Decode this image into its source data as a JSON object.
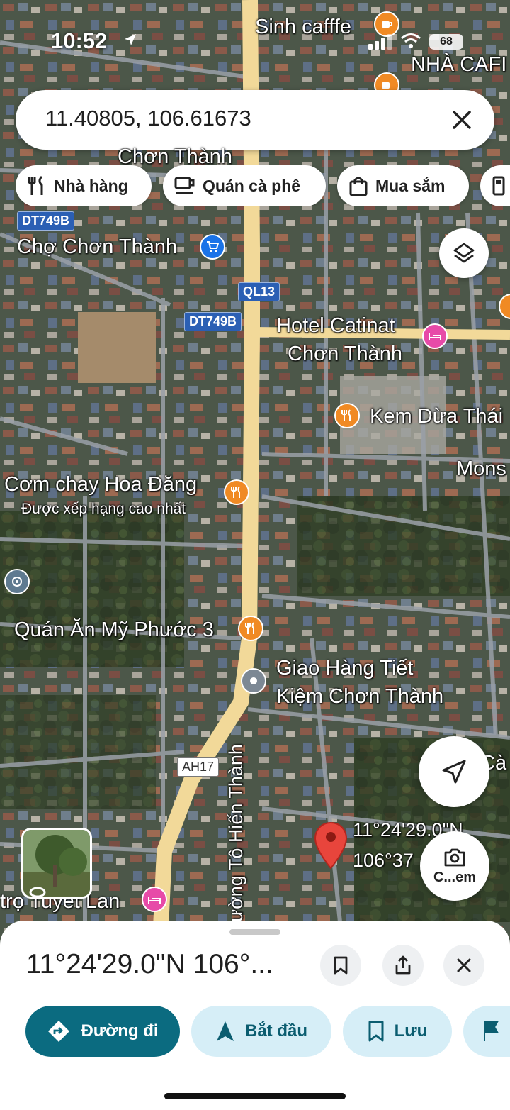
{
  "status_bar": {
    "time": "10:52",
    "battery": "68"
  },
  "search": {
    "value": "11.40805, 106.61673",
    "clear_icon": "close-icon"
  },
  "chips": [
    {
      "label": "Nhà hàng",
      "icon": "restaurant-icon"
    },
    {
      "label": "Quán cà phê",
      "icon": "coffee-icon"
    },
    {
      "label": "Mua sắm",
      "icon": "shopping-bag-icon"
    },
    {
      "label": "",
      "icon": "gas-station-icon"
    }
  ],
  "map": {
    "road_shields": [
      "DT749B",
      "QL13",
      "DT749B",
      "AH17"
    ],
    "places": [
      {
        "name": "Sinh cafffe",
        "icon": "coffee-icon"
      },
      {
        "name": "NHÀ CAFI",
        "icon": "coffee-icon"
      },
      {
        "name": "Chơn Thành",
        "icon": ""
      },
      {
        "name": "Chợ Chơn Thành",
        "icon": "shopping-cart-icon"
      },
      {
        "name": "Hotel Catinat",
        "name2": "Chơn Thành",
        "icon": "hotel-icon"
      },
      {
        "name": "Kem Dừa Thái",
        "icon": "restaurant-icon"
      },
      {
        "name": "Mons",
        "icon": ""
      },
      {
        "name": "Cơm chay Hoa Đăng",
        "subtitle": "Được xếp hạng cao nhất",
        "icon": "restaurant-icon"
      },
      {
        "name": "Quán Ăn Mỹ Phước 3",
        "icon": "restaurant-icon"
      },
      {
        "name": "Giao Hàng Tiết",
        "name2": "Kiệm Chơn Thành",
        "icon": "place-icon"
      },
      {
        "name": "trọ Tuyết Lan",
        "icon": "hotel-icon"
      },
      {
        "name": "Cà",
        "icon": ""
      }
    ],
    "street_label": "ường Tô Hiến Thành",
    "pin_label_1": "11°24'29.0\"N",
    "pin_label_2": "106°37",
    "camera_label": "C...em"
  },
  "sheet": {
    "title": "11°24'29.0\"N 106°...",
    "actions": [
      {
        "label": "Đường đi",
        "icon": "directions-icon"
      },
      {
        "label": "Bắt đầu",
        "icon": "navigation-arrow-icon"
      },
      {
        "label": "Lưu",
        "icon": "bookmark-icon"
      },
      {
        "label": "",
        "icon": "flag-icon"
      }
    ]
  },
  "colors": {
    "primary": "#0b6b80",
    "secondary_bg": "#d6eef7",
    "road": "#f2d999",
    "pin_red": "#e8453c"
  }
}
